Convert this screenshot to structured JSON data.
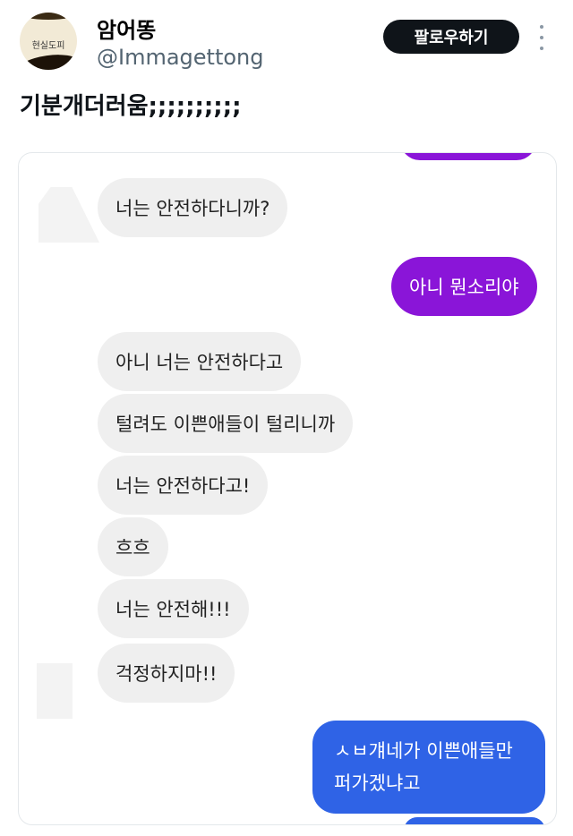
{
  "profile": {
    "avatar_text": "현실도피",
    "name": "암어똥",
    "handle": "@Immagettong"
  },
  "follow_button": "팔로우하기",
  "tweet": {
    "text": "기분개더러움;;;;;;;;;;"
  },
  "chat": {
    "messages": [
      {
        "side": "received",
        "text": "너는 안전하다니까?"
      },
      {
        "side": "sent",
        "text": "아니 뭔소리야"
      },
      {
        "side": "received",
        "text": "아니 너는 안전하다고"
      },
      {
        "side": "received",
        "text": "털려도 이쁜애들이 털리니까"
      },
      {
        "side": "received",
        "text": "너는 안전하다고!"
      },
      {
        "side": "received",
        "text": "흐흐"
      },
      {
        "side": "received",
        "text": "너는 안전해!!!"
      },
      {
        "side": "received",
        "text": "걱정하지마!!"
      },
      {
        "side": "sent",
        "text_line1": "ㅅㅂ걔네가 이쁜애들만",
        "text_line2": "퍼가겠냐고"
      }
    ]
  },
  "colors": {
    "sent_purple": "#8a15d8",
    "sent_blue": "#2f63e6",
    "received": "#efefef",
    "follow_button": "#0f1419",
    "handle": "#536471"
  },
  "icons": [
    "more-vertical-icon"
  ]
}
